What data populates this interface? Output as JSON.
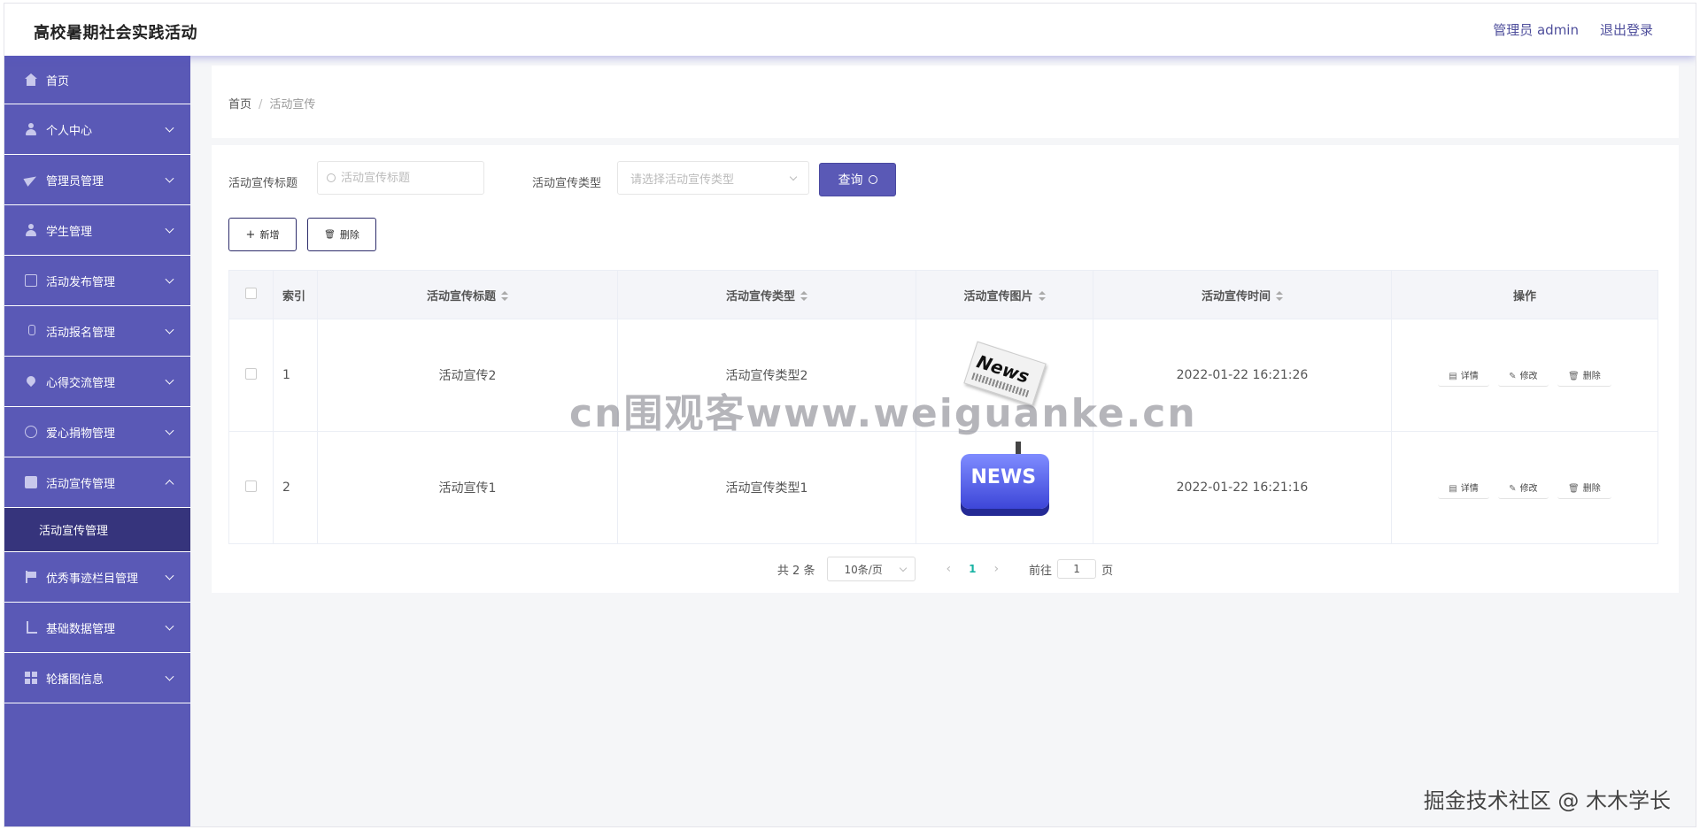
{
  "header": {
    "site_title": "高校暑期社会实践活动",
    "user_label": "管理员 admin",
    "logout": "退出登录"
  },
  "sidebar": {
    "items": [
      {
        "label": "首页",
        "icon": "home-icon"
      },
      {
        "label": "个人中心",
        "icon": "person-icon"
      },
      {
        "label": "管理员管理",
        "icon": "send-icon"
      },
      {
        "label": "学生管理",
        "icon": "person-icon"
      },
      {
        "label": "活动发布管理",
        "icon": "copy-icon"
      },
      {
        "label": "活动报名管理",
        "icon": "mic-icon"
      },
      {
        "label": "心得交流管理",
        "icon": "drop-icon"
      },
      {
        "label": "爱心捐物管理",
        "icon": "circle-icon"
      },
      {
        "label": "活动宣传管理",
        "icon": "check-icon",
        "expanded": true
      },
      {
        "label": "优秀事迹栏目管理",
        "icon": "flag-icon"
      },
      {
        "label": "基础数据管理",
        "icon": "crop-icon"
      },
      {
        "label": "轮播图信息",
        "icon": "grid-icon"
      }
    ],
    "submenu": {
      "label": "活动宣传管理"
    }
  },
  "breadcrumb": {
    "home": "首页",
    "separator": "/",
    "current": "活动宣传"
  },
  "filters": {
    "title_label": "活动宣传标题",
    "title_placeholder": "活动宣传标题",
    "type_label": "活动宣传类型",
    "type_placeholder": "请选择活动宣传类型",
    "query_button": "查询"
  },
  "actions": {
    "add": "新增",
    "delete": "删除"
  },
  "table": {
    "headers": {
      "index": "索引",
      "title": "活动宣传标题",
      "type": "活动宣传类型",
      "image": "活动宣传图片",
      "time": "活动宣传时间",
      "ops": "操作"
    },
    "rows": [
      {
        "index": "1",
        "title": "活动宣传2",
        "type": "活动宣传类型2",
        "image_text": "News",
        "time": "2022-01-22 16:21:26"
      },
      {
        "index": "2",
        "title": "活动宣传1",
        "type": "活动宣传类型1",
        "image_text": "NEWS",
        "time": "2022-01-22 16:21:16"
      }
    ],
    "row_ops": {
      "detail": "详情",
      "edit": "修改",
      "delete": "删除"
    }
  },
  "pagination": {
    "total": "共 2 条",
    "page_size": "10条/页",
    "current_page": "1",
    "goto_prefix": "前往",
    "goto_value": "1",
    "goto_suffix": "页"
  },
  "watermarks": {
    "center": "cn围观客www.weiguanke.cn",
    "corner": "掘金技术社区 @ 木木学长"
  },
  "colors": {
    "sidebar": "#5a59b6",
    "sidebar_active": "#36347c",
    "accent": "#5a59b6",
    "page_active": "#17b3a3"
  }
}
